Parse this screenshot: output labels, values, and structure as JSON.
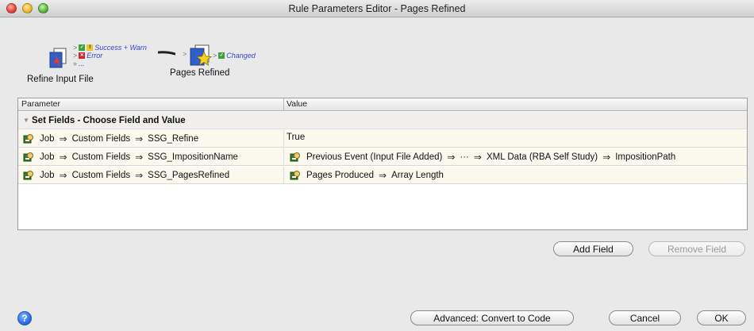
{
  "window": {
    "title": "Rule Parameters Editor - Pages Refined"
  },
  "flow": {
    "source": {
      "label": "Refine Input File",
      "icon": "pdf-document-icon"
    },
    "target": {
      "label": "Pages Refined",
      "icon": "star-document-icon"
    },
    "outputs": {
      "success_warn": "Success + Warn",
      "error": "Error",
      "more": "...",
      "changed": "Changed"
    }
  },
  "table": {
    "columns": {
      "parameter": "Parameter",
      "value": "Value"
    },
    "group": "Set Fields - Choose Field and Value",
    "arrow": "⇒",
    "rows": [
      {
        "param": [
          "Job",
          "Custom Fields",
          "SSG_Refine"
        ],
        "value_plain": "True"
      },
      {
        "param": [
          "Job",
          "Custom Fields",
          "SSG_ImpositionName"
        ],
        "value": [
          "Previous Event (Input File Added)",
          "···",
          "XML Data (RBA Self Study)",
          "ImpositionPath"
        ]
      },
      {
        "param": [
          "Job",
          "Custom Fields",
          "SSG_PagesRefined"
        ],
        "value": [
          "Pages Produced",
          "Array Length"
        ]
      }
    ]
  },
  "buttons": {
    "add_field": "Add Field",
    "remove_field": "Remove Field",
    "advanced": "Advanced: Convert to Code",
    "cancel": "Cancel",
    "ok": "OK",
    "help": "?"
  },
  "colors": {
    "row_bg": "#fbf8ee",
    "group_bg": "#f0efed",
    "link_blue": "#3344cc"
  }
}
